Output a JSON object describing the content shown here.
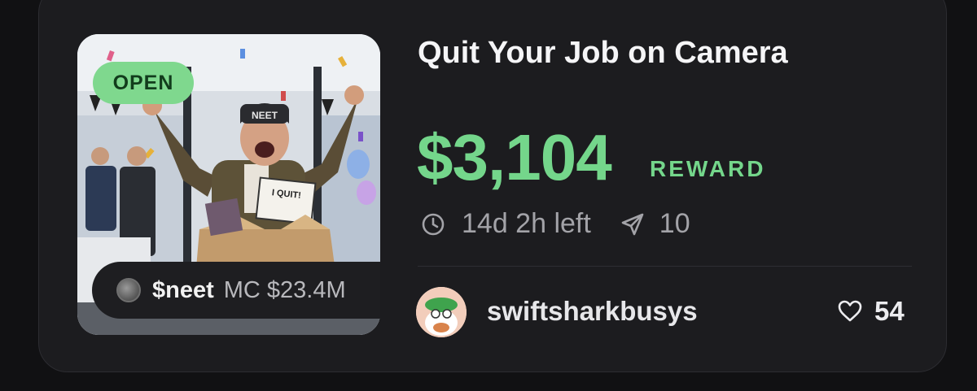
{
  "listing": {
    "status_badge": "OPEN",
    "title": "Quit Your Job on Camera",
    "reward_amount": "$3,104",
    "reward_label": "REWARD",
    "time_left": "14d 2h left",
    "submissions": "10",
    "token": {
      "symbol": "$neet",
      "market_cap": "MC $23.4M"
    },
    "creator": {
      "username": "swiftsharkbusys"
    },
    "likes": "54",
    "thumbnail": {
      "cap_text": "NEET",
      "sign_text": "I QUIT!"
    }
  },
  "icons": {
    "time": "clock-icon",
    "submissions": "send-icon",
    "likes": "heart-icon",
    "token": "token-icon"
  },
  "colors": {
    "background": "#111113",
    "card": "#1c1c1f",
    "accent_green": "#74d68b",
    "badge_green": "#7fd88e",
    "muted_text": "#a3a3a8"
  }
}
